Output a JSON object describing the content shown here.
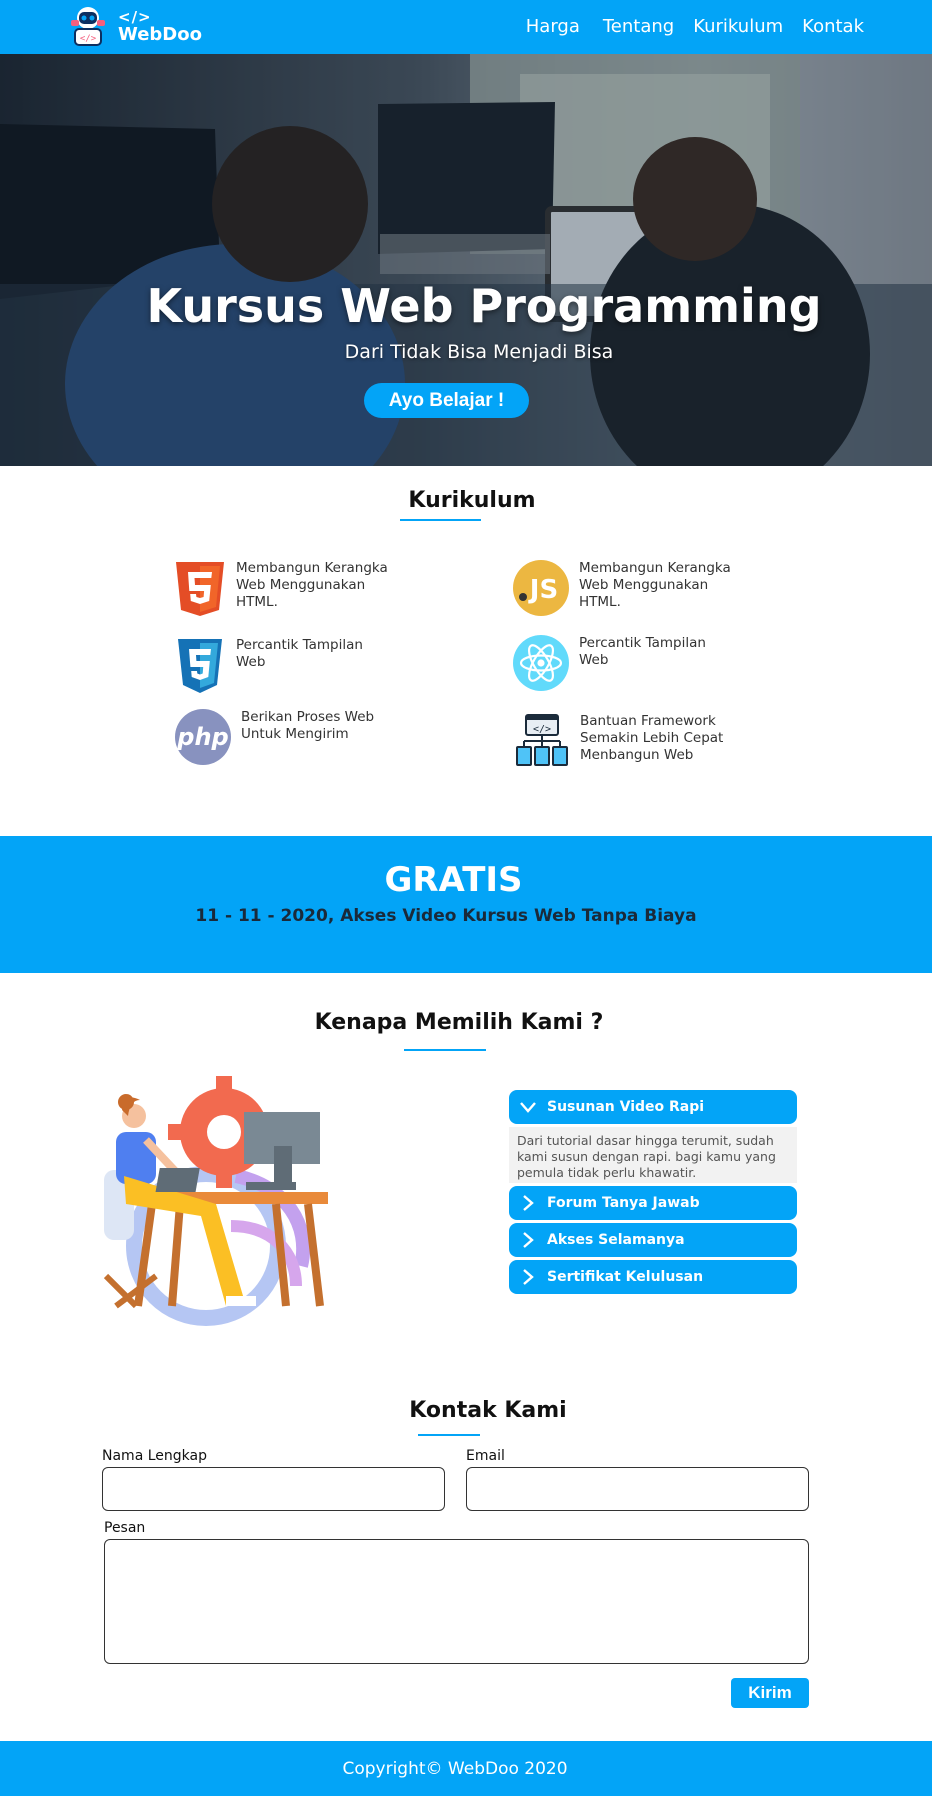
{
  "brand": {
    "code_mark": "</>",
    "name": "WebDoo"
  },
  "nav": [
    "Harga",
    "Tentang",
    "Kurikulum",
    "Kontak"
  ],
  "hero": {
    "title": "Kursus Web Programming",
    "subtitle": "Dari Tidak Bisa Menjadi Bisa",
    "cta": "Ayo Belajar !"
  },
  "curriculum": {
    "title": "Kurikulum",
    "items": [
      {
        "icon": "html5-icon",
        "text": "Membangun Kerangka Web Menggunakan HTML."
      },
      {
        "icon": "javascript-icon",
        "text": "Membangun Kerangka Web Menggunakan HTML."
      },
      {
        "icon": "css3-icon",
        "text": "Percantik Tampilan Web"
      },
      {
        "icon": "react-icon",
        "text": "Percantik Tampilan Web"
      },
      {
        "icon": "php-icon",
        "text": "Berikan Proses Web Untuk Mengirim"
      },
      {
        "icon": "framework-icon",
        "text": "Bantuan Framework Semakin Lebih Cepat Menbangun Web"
      }
    ]
  },
  "promo": {
    "title": "GRATIS",
    "subtitle": "11 - 11 - 2020, Akses Video Kursus Web Tanpa Biaya"
  },
  "why": {
    "title": "Kenapa Memilih Kami ?",
    "accordion": [
      {
        "label": "Susunan Video Rapi",
        "expanded": true,
        "body": "Dari tutorial dasar hingga terumit, sudah kami susun dengan rapi. bagi kamu yang pemula tidak perlu khawatir."
      },
      {
        "label": "Forum Tanya Jawab",
        "expanded": false
      },
      {
        "label": "Akses Selamanya",
        "expanded": false
      },
      {
        "label": "Sertifikat Kelulusan",
        "expanded": false
      }
    ]
  },
  "contact": {
    "title": "Kontak Kami",
    "name_label": "Nama Lengkap",
    "email_label": "Email",
    "message_label": "Pesan",
    "submit": "Kirim"
  },
  "footer": {
    "text": "Copyright© WebDoo 2020"
  },
  "colors": {
    "primary": "#03a4f7",
    "dark_text": "#1a2a3a"
  }
}
